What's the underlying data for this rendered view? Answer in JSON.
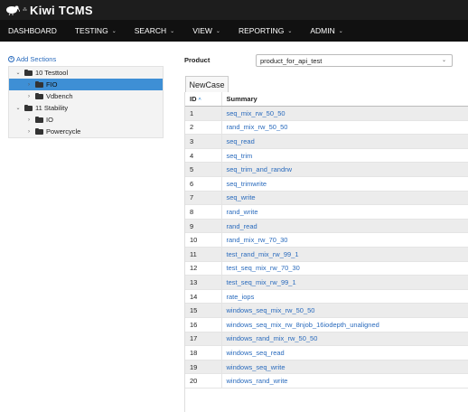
{
  "header": {
    "logo_small": "⁂",
    "brand": "Kiwi TCMS"
  },
  "nav": [
    {
      "label": "DASHBOARD",
      "caret": ""
    },
    {
      "label": "TESTING",
      "caret": "⌄"
    },
    {
      "label": "SEARCH",
      "caret": "⌄"
    },
    {
      "label": "VIEW",
      "caret": "⌄"
    },
    {
      "label": "REPORTING",
      "caret": "⌄"
    },
    {
      "label": "ADMIN",
      "caret": "⌄"
    }
  ],
  "tree": {
    "add_label": "Add Sections",
    "nodes": [
      {
        "label": "10 Testtool",
        "chev": "⌄"
      },
      {
        "label": "FIO",
        "chev": "›"
      },
      {
        "label": "Vdbench",
        "chev": "›"
      },
      {
        "label": "11 Stability",
        "chev": "⌄"
      },
      {
        "label": "IO",
        "chev": "›"
      },
      {
        "label": "Powercycle",
        "chev": "›"
      }
    ]
  },
  "product": {
    "label": "Product",
    "selected": "product_for_api_test"
  },
  "newcase_label": "NewCase",
  "table": {
    "headers": {
      "id": "ID",
      "summary": "Summary",
      "sort_icon": "^"
    },
    "rows": [
      {
        "id": "1",
        "summary": "seq_mix_rw_50_50"
      },
      {
        "id": "2",
        "summary": "rand_mix_rw_50_50"
      },
      {
        "id": "3",
        "summary": "seq_read"
      },
      {
        "id": "4",
        "summary": "seq_trim"
      },
      {
        "id": "5",
        "summary": "seq_trim_and_randrw"
      },
      {
        "id": "6",
        "summary": "seq_trimwrite"
      },
      {
        "id": "7",
        "summary": "seq_write"
      },
      {
        "id": "8",
        "summary": "rand_write"
      },
      {
        "id": "9",
        "summary": "rand_read"
      },
      {
        "id": "10",
        "summary": "rand_mix_rw_70_30"
      },
      {
        "id": "11",
        "summary": "test_rand_mix_rw_99_1"
      },
      {
        "id": "12",
        "summary": "test_seq_mix_rw_70_30"
      },
      {
        "id": "13",
        "summary": "test_seq_mix_rw_99_1"
      },
      {
        "id": "14",
        "summary": "rate_iops"
      },
      {
        "id": "15",
        "summary": "windows_seq_mix_rw_50_50"
      },
      {
        "id": "16",
        "summary": "windows_seq_mix_rw_8njob_16iodepth_unaligned"
      },
      {
        "id": "17",
        "summary": "windows_rand_mix_rw_50_50"
      },
      {
        "id": "18",
        "summary": "windows_seq_read"
      },
      {
        "id": "19",
        "summary": "windows_seq_write"
      },
      {
        "id": "20",
        "summary": "windows_rand_write"
      }
    ]
  },
  "colors": {
    "accent": "#3e8fd5",
    "link": "#2a6bbd",
    "header_bg": "#1d1d1d",
    "nav_bg": "#111111"
  }
}
